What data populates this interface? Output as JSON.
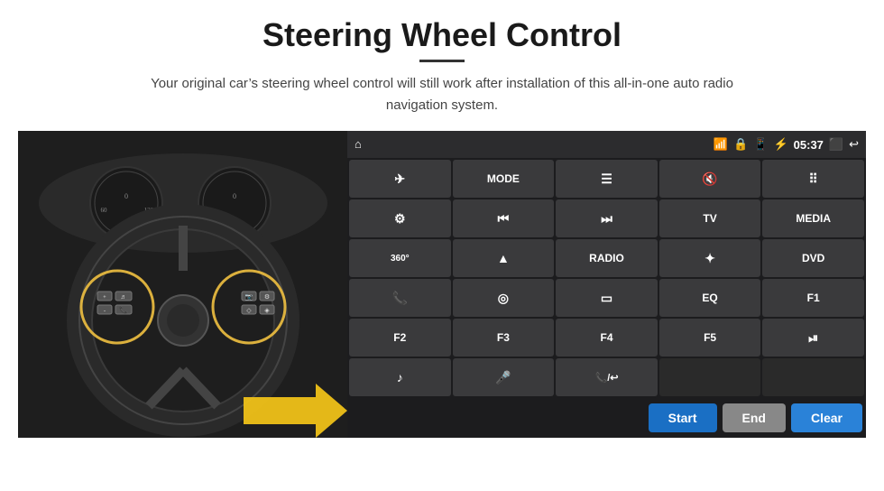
{
  "header": {
    "title": "Steering Wheel Control",
    "divider": true,
    "subtitle": "Your original car’s steering wheel control will still work after installation of this all-in-one auto radio navigation system."
  },
  "statusBar": {
    "time": "05:37",
    "icons": [
      "home",
      "wifi",
      "lock",
      "sim",
      "bluetooth",
      "signal",
      "screenshot",
      "back"
    ]
  },
  "buttons": [
    {
      "id": "r1c1",
      "icon": "✈",
      "label": ""
    },
    {
      "id": "r1c2",
      "icon": "",
      "label": "MODE"
    },
    {
      "id": "r1c3",
      "icon": "☰",
      "label": ""
    },
    {
      "id": "r1c4",
      "icon": "🔇",
      "label": ""
    },
    {
      "id": "r1c5",
      "icon": "⠿",
      "label": ""
    },
    {
      "id": "r2c1",
      "icon": "⊙",
      "label": ""
    },
    {
      "id": "r2c2",
      "icon": "⏮",
      "label": ""
    },
    {
      "id": "r2c3",
      "icon": "⏭",
      "label": ""
    },
    {
      "id": "r2c4",
      "icon": "",
      "label": "TV"
    },
    {
      "id": "r2c5",
      "icon": "",
      "label": "MEDIA"
    },
    {
      "id": "r3c1",
      "icon": "360",
      "label": ""
    },
    {
      "id": "r3c2",
      "icon": "▲",
      "label": ""
    },
    {
      "id": "r3c3",
      "icon": "",
      "label": "RADIO"
    },
    {
      "id": "r3c4",
      "icon": "✦",
      "label": ""
    },
    {
      "id": "r3c5",
      "icon": "",
      "label": "DVD"
    },
    {
      "id": "r4c1",
      "icon": "📞",
      "label": ""
    },
    {
      "id": "r4c2",
      "icon": "◎",
      "label": ""
    },
    {
      "id": "r4c3",
      "icon": "▭",
      "label": ""
    },
    {
      "id": "r4c4",
      "icon": "",
      "label": "EQ"
    },
    {
      "id": "r4c5",
      "icon": "",
      "label": "F1"
    },
    {
      "id": "r5c1",
      "icon": "",
      "label": "F2"
    },
    {
      "id": "r5c2",
      "icon": "",
      "label": "F3"
    },
    {
      "id": "r5c3",
      "icon": "",
      "label": "F4"
    },
    {
      "id": "r5c4",
      "icon": "",
      "label": "F5"
    },
    {
      "id": "r5c5",
      "icon": "⏯",
      "label": ""
    },
    {
      "id": "r6c1",
      "icon": "♪",
      "label": ""
    },
    {
      "id": "r6c2",
      "icon": "🎤",
      "label": ""
    },
    {
      "id": "r6c3",
      "icon": "📞",
      "label": ""
    }
  ],
  "actionBar": {
    "startLabel": "Start",
    "endLabel": "End",
    "clearLabel": "Clear"
  }
}
